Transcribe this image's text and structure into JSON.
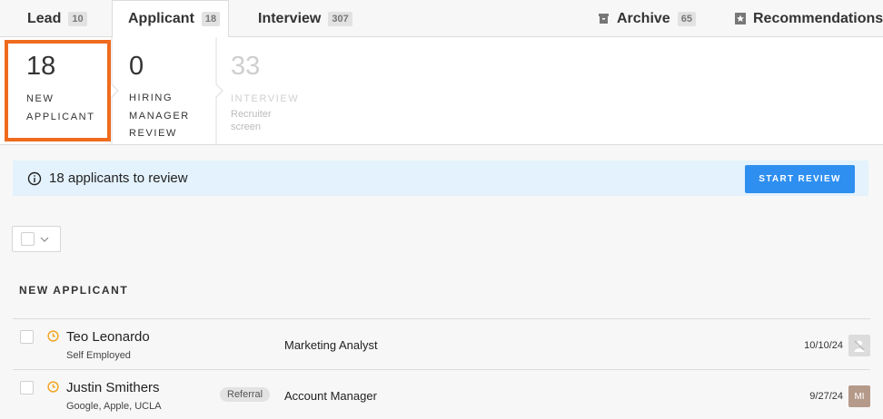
{
  "tabs": [
    {
      "label": "Lead",
      "count": "10"
    },
    {
      "label": "Applicant",
      "count": "18"
    },
    {
      "label": "Interview",
      "count": "307"
    },
    {
      "label": "Archive",
      "count": "65"
    },
    {
      "label": "Recommendations",
      "count": ""
    }
  ],
  "stages": [
    {
      "count": "18",
      "label_line1": "NEW",
      "label_line2": "APPLICANT",
      "label_line3": "",
      "sub_line1": "",
      "sub_line2": ""
    },
    {
      "count": "0",
      "label_line1": "HIRING",
      "label_line2": "MANAGER",
      "label_line3": "REVIEW",
      "sub_line1": "",
      "sub_line2": ""
    },
    {
      "count": "33",
      "label_line1": "INTERVIEW",
      "label_line2": "",
      "label_line3": "",
      "sub_line1": "Recruiter",
      "sub_line2": "screen"
    }
  ],
  "banner": {
    "text": "18 applicants to review",
    "button": "START REVIEW"
  },
  "section": {
    "title": "NEW APPLICANT"
  },
  "rows": [
    {
      "name": "Teo Leonardo",
      "org": "Self Employed",
      "tag": "",
      "role": "Marketing Analyst",
      "date": "10/10/24",
      "avatar": ""
    },
    {
      "name": "Justin Smithers",
      "org": "Google, Apple, UCLA",
      "tag": "Referral",
      "role": "Account Manager",
      "date": "9/27/24",
      "avatar": "MI"
    }
  ],
  "colors": {
    "highlight": "#ee6b1f",
    "accent": "#2e8ff0",
    "banner_bg": "#e3f2fc",
    "clock": "#f0a626"
  }
}
